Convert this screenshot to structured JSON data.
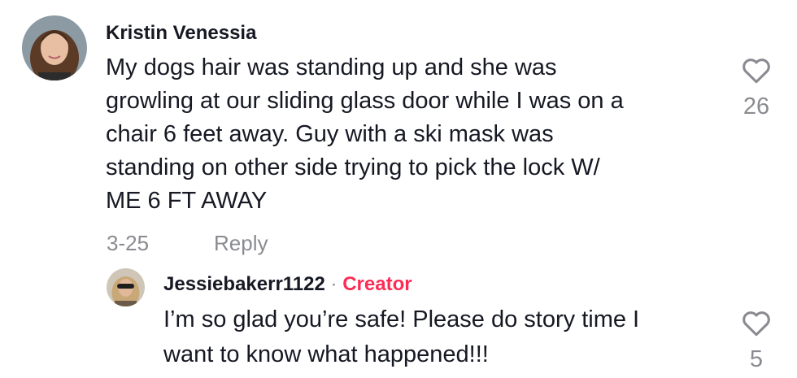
{
  "comment": {
    "username": "Kristin Venessia",
    "lines": [
      "My dogs hair was standing up and she was",
      "growling at our sliding glass door while I was on a",
      "chair 6 feet away. Guy with a ski mask was",
      "standing on other side trying to pick the lock W/",
      "ME 6 FT AWAY"
    ],
    "date": "3-25",
    "reply_label": "Reply",
    "likes": "26",
    "like_icon": "heart-outline-icon"
  },
  "reply": {
    "username": "Jessiebakerr1122",
    "separator": "·",
    "badge": "Creator",
    "lines": [
      "I’m so glad you’re safe! Please do story time I",
      "want to know what happened!!!"
    ],
    "likes": "5",
    "like_icon": "heart-outline-icon"
  },
  "colors": {
    "text": "#161823",
    "muted": "#8a8b91",
    "creator": "#fe2c55"
  }
}
